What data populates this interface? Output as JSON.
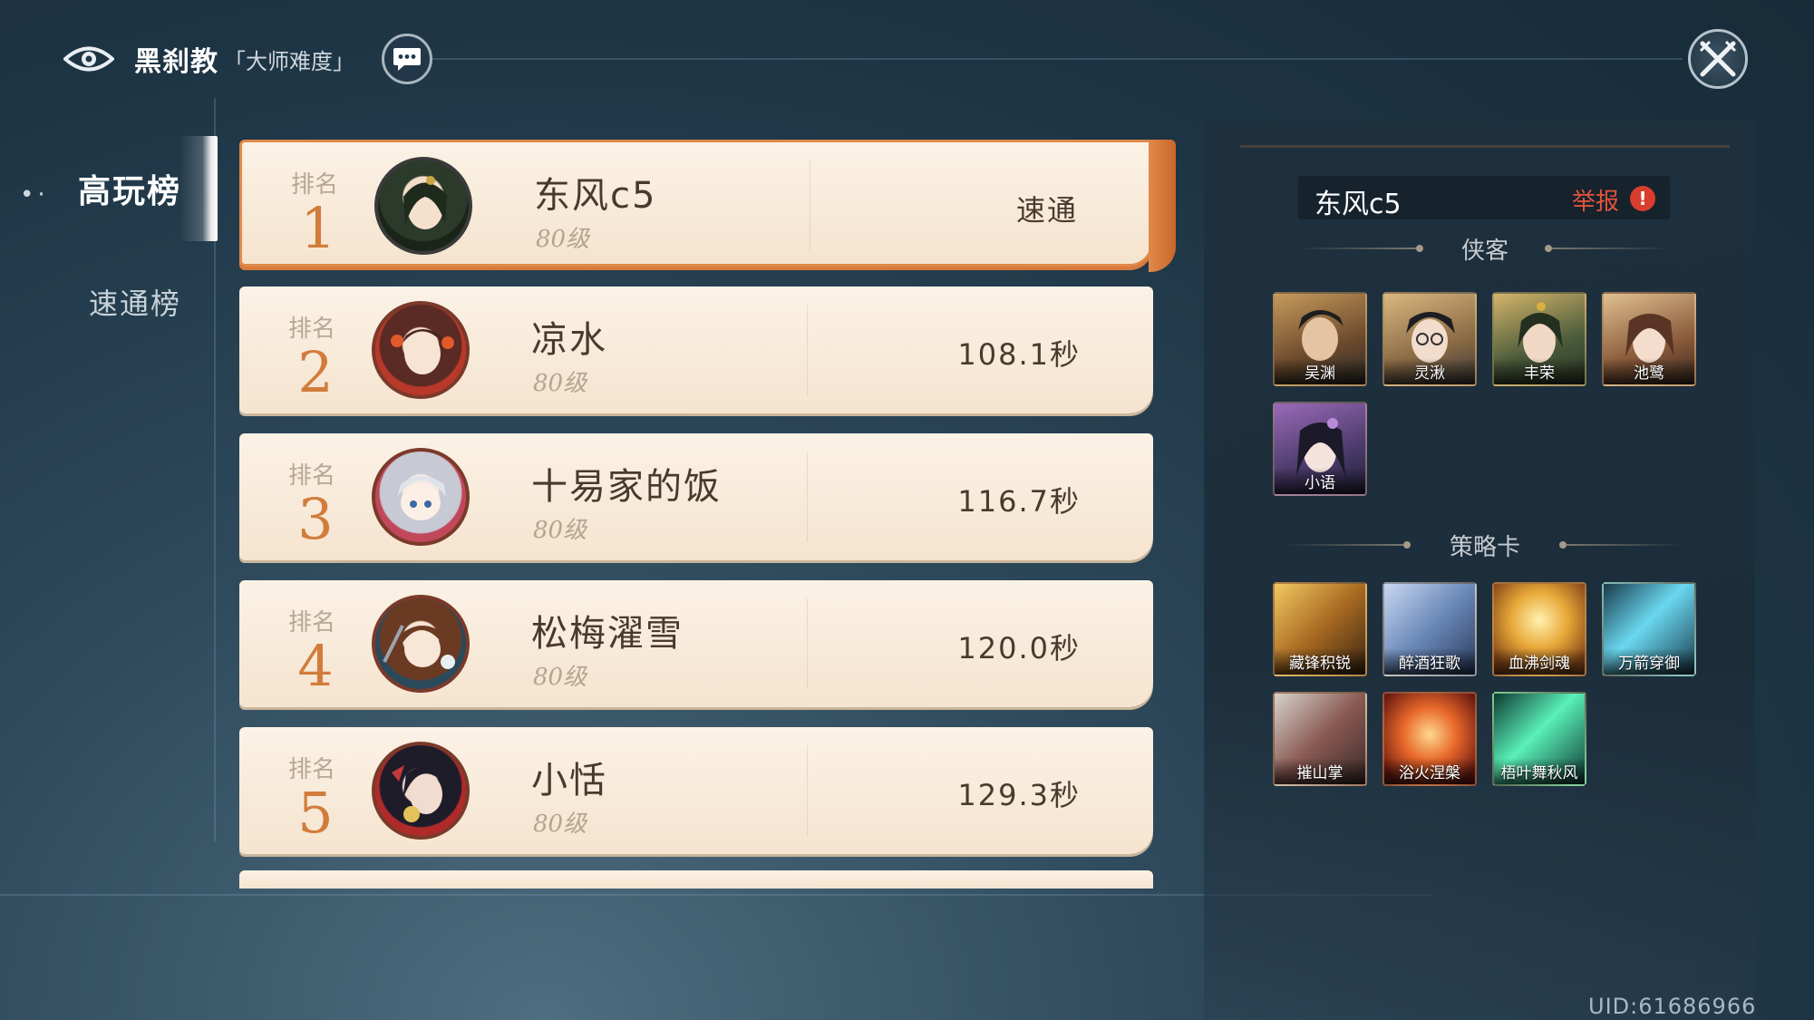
{
  "header": {
    "dungeon_name": "黑刹教",
    "difficulty": "「大师难度」"
  },
  "tabs": [
    {
      "label": "高玩榜",
      "active": true
    },
    {
      "label": "速通榜",
      "active": false
    }
  ],
  "rankings": [
    {
      "rank_label": "排名",
      "rank": "1",
      "name": "东风c5",
      "level": "80级",
      "result": "速通"
    },
    {
      "rank_label": "排名",
      "rank": "2",
      "name": "凉水",
      "level": "80级",
      "result": "108.1秒"
    },
    {
      "rank_label": "排名",
      "rank": "3",
      "name": "十易家的饭",
      "level": "80级",
      "result": "116.7秒"
    },
    {
      "rank_label": "排名",
      "rank": "4",
      "name": "松梅濯雪",
      "level": "80级",
      "result": "120.0秒"
    },
    {
      "rank_label": "排名",
      "rank": "5",
      "name": "小恬",
      "level": "80级",
      "result": "129.3秒"
    }
  ],
  "detail": {
    "player_name": "东风c5",
    "report_label": "举报",
    "heroes_title": "侠客",
    "heroes": [
      "吴渊",
      "灵湫",
      "丰荣",
      "池鹭",
      "小语"
    ],
    "cards_title": "策略卡",
    "cards": [
      "藏锋积锐",
      "醉酒狂歌",
      "血沸剑魂",
      "万箭穿御",
      "摧山掌",
      "浴火涅槃",
      "梧叶舞秋风"
    ]
  },
  "uid": "UID:61686966",
  "colors": {
    "accent_orange": "#d27c3c",
    "report_red": "#e1533b",
    "card_bg": "#f8ead9"
  }
}
